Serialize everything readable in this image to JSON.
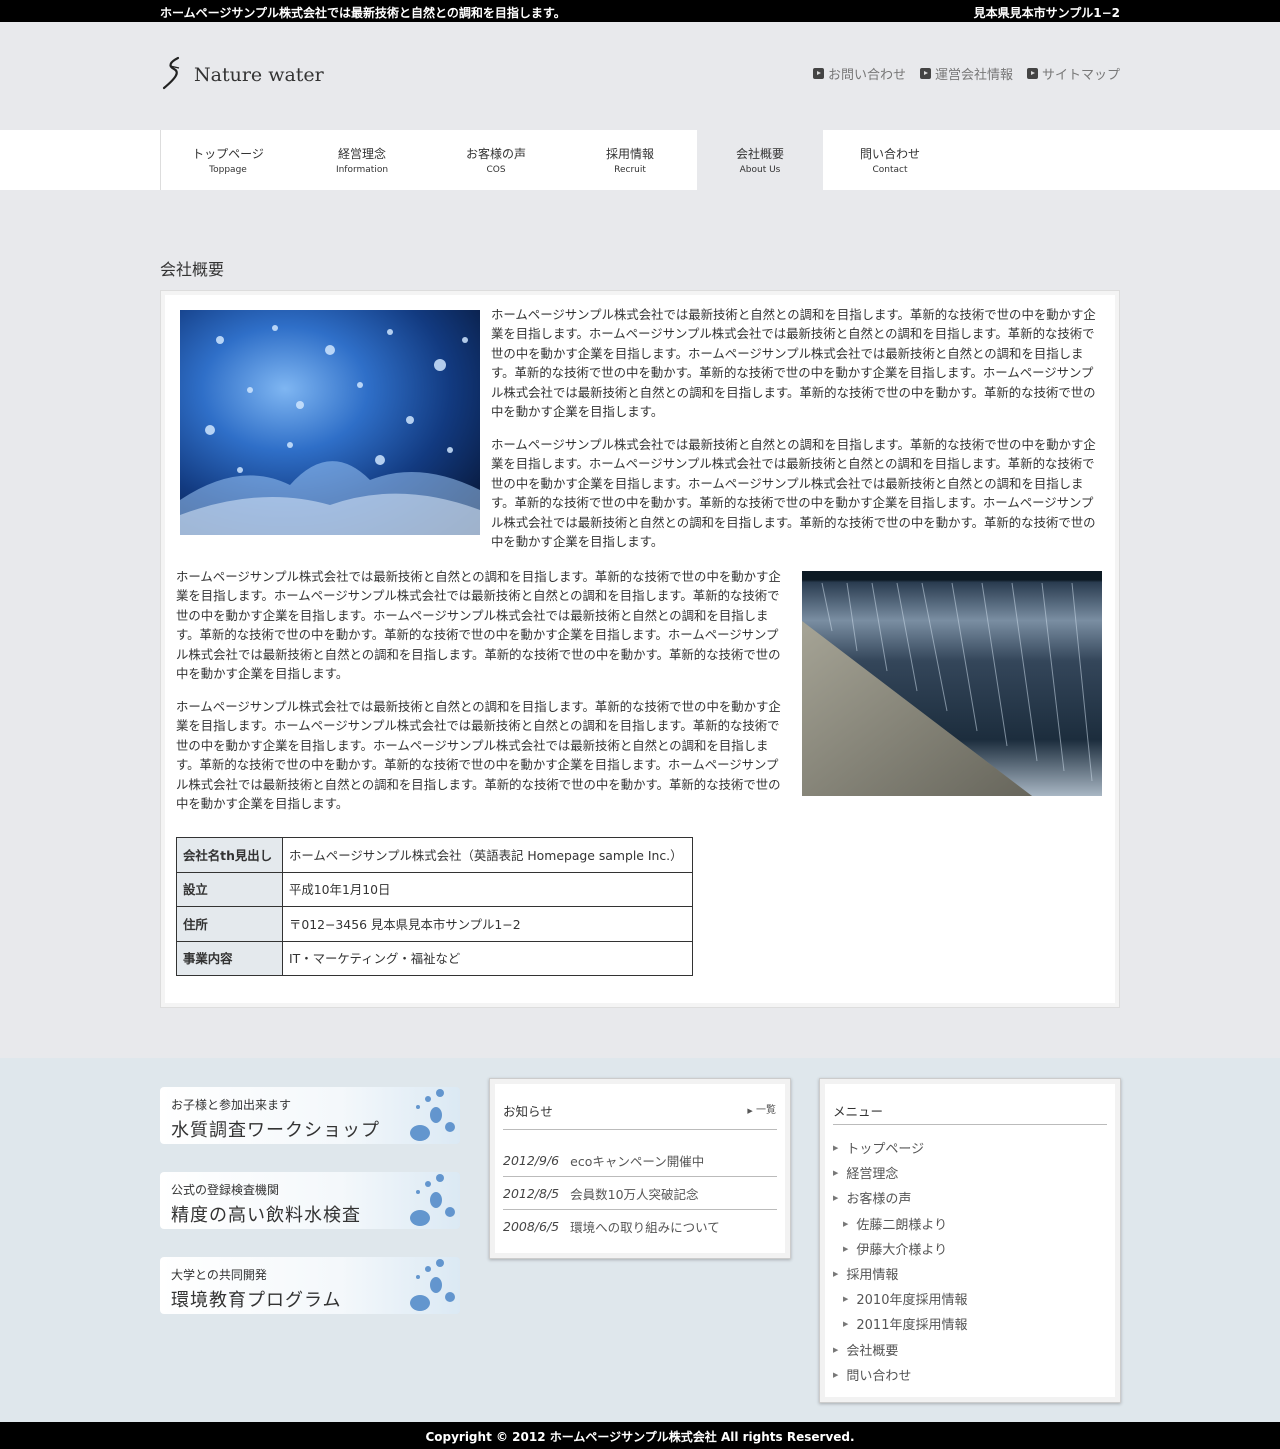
{
  "topbar": {
    "tagline": "ホームページサンプル株式会社では最新技術と自然との調和を目指します。",
    "address": "見本県見本市サンプル1−2"
  },
  "header": {
    "logo_text": "Nature water",
    "links": [
      {
        "label": "お問い合わせ"
      },
      {
        "label": "運営会社情報"
      },
      {
        "label": "サイトマップ"
      }
    ]
  },
  "nav": {
    "tabs": [
      {
        "jp": "トップページ",
        "en": "Toppage"
      },
      {
        "jp": "経営理念",
        "en": "Information"
      },
      {
        "jp": "お客様の声",
        "en": "COS"
      },
      {
        "jp": "採用情報",
        "en": "Recruit"
      },
      {
        "jp": "会社概要",
        "en": "About Us"
      },
      {
        "jp": "問い合わせ",
        "en": "Contact"
      }
    ],
    "active": "会社概要"
  },
  "main": {
    "title": "会社概要",
    "paragraphs": [
      "ホームページサンプル株式会社では最新技術と自然との調和を目指します。革新的な技術で世の中を動かす企業を目指します。ホームページサンプル株式会社では最新技術と自然との調和を目指します。革新的な技術で世の中を動かす企業を目指します。ホームページサンプル株式会社では最新技術と自然との調和を目指します。革新的な技術で世の中を動かす。革新的な技術で世の中を動かす企業を目指します。ホームページサンプル株式会社では最新技術と自然との調和を目指します。革新的な技術で世の中を動かす。革新的な技術で世の中を動かす企業を目指します。",
      "ホームページサンプル株式会社では最新技術と自然との調和を目指します。革新的な技術で世の中を動かす企業を目指します。ホームページサンプル株式会社では最新技術と自然との調和を目指します。革新的な技術で世の中を動かす企業を目指します。ホームページサンプル株式会社では最新技術と自然との調和を目指します。革新的な技術で世の中を動かす。革新的な技術で世の中を動かす企業を目指します。ホームページサンプル株式会社では最新技術と自然との調和を目指します。革新的な技術で世の中を動かす。革新的な技術で世の中を動かす企業を目指します。",
      "ホームページサンプル株式会社では最新技術と自然との調和を目指します。革新的な技術で世の中を動かす企業を目指します。ホームページサンプル株式会社では最新技術と自然との調和を目指します。革新的な技術で世の中を動かす企業を目指します。ホームページサンプル株式会社では最新技術と自然との調和を目指します。革新的な技術で世の中を動かす。革新的な技術で世の中を動かす企業を目指します。ホームページサンプル株式会社では最新技術と自然との調和を目指します。革新的な技術で世の中を動かす。革新的な技術で世の中を動かす企業を目指します。",
      "ホームページサンプル株式会社では最新技術と自然との調和を目指します。革新的な技術で世の中を動かす企業を目指します。ホームページサンプル株式会社では最新技術と自然との調和を目指します。革新的な技術で世の中を動かす企業を目指します。ホームページサンプル株式会社では最新技術と自然との調和を目指します。革新的な技術で世の中を動かす。革新的な技術で世の中を動かす企業を目指します。ホームページサンプル株式会社では最新技術と自然との調和を目指します。革新的な技術で世の中を動かす。革新的な技術で世の中を動かす企業を目指します。"
    ],
    "table": [
      {
        "th": "会社名th見出し",
        "td": "ホームページサンプル株式会社（英語表記 Homepage sample Inc.）"
      },
      {
        "th": "設立",
        "td": "平成10年1月10日"
      },
      {
        "th": "住所",
        "td": "〒012−3456 見本県見本市サンプル1−2"
      },
      {
        "th": "事業内容",
        "td": "IT・マーケティング・福祉など"
      }
    ]
  },
  "banners": [
    {
      "small": "お子様と参加出来ます",
      "big": "水質調査ワークショップ"
    },
    {
      "small": "公式の登録検査機関",
      "big": "精度の高い飲料水検査"
    },
    {
      "small": "大学との共同開発",
      "big": "環境教育プログラム"
    }
  ],
  "news": {
    "title": "お知らせ",
    "more": "一覧",
    "items": [
      {
        "date": "2012/9/6",
        "text": "ecoキャンペーン開催中"
      },
      {
        "date": "2012/8/5",
        "text": "会員数10万人突破記念"
      },
      {
        "date": "2008/6/5",
        "text": "環境への取り組みについて"
      }
    ]
  },
  "menu": {
    "title": "メニュー",
    "items": [
      {
        "label": "トップページ"
      },
      {
        "label": "経営理念"
      },
      {
        "label": "お客様の声"
      },
      {
        "label": "佐藤二朗様より"
      },
      {
        "label": "伊藤大介様より"
      },
      {
        "label": "採用情報"
      },
      {
        "label": "2010年度採用情報"
      },
      {
        "label": "2011年度採用情報"
      },
      {
        "label": "会社概要"
      },
      {
        "label": "問い合わせ"
      }
    ]
  },
  "footer": {
    "copyright": "Copyright © 2012 ホームページサンプル株式会社 All rights Reserved."
  }
}
